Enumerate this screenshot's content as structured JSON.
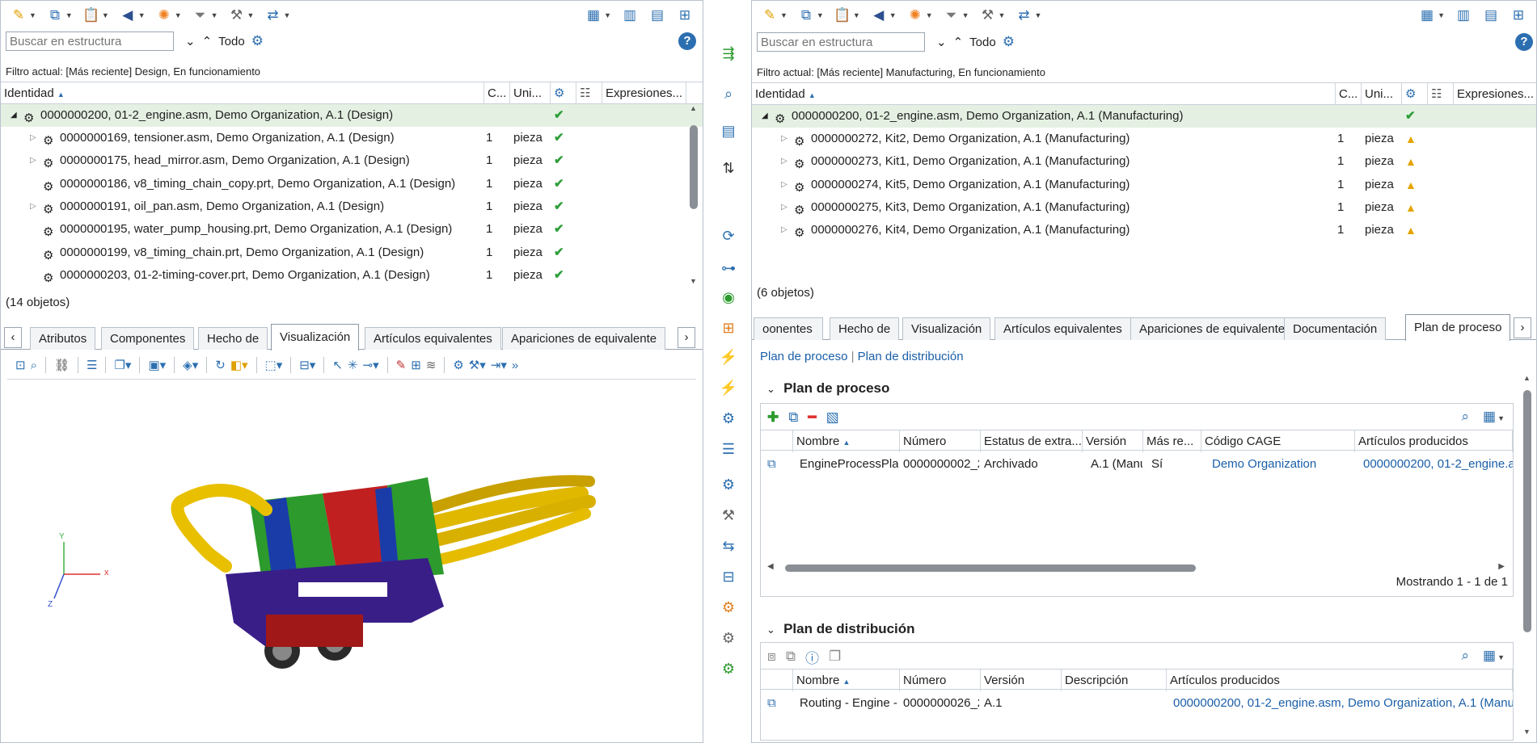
{
  "left": {
    "search": {
      "placeholder": "Buscar en estructura"
    },
    "all_label": "Todo",
    "filter": "Filtro actual: [Más reciente] Design, En funcionamiento",
    "columns": [
      "Identidad",
      "C...",
      "Uni...",
      "Expresiones..."
    ],
    "root": {
      "text": "0000000200, 01-2_engine.asm, Demo Organization, A.1 (Design)"
    },
    "rows": [
      {
        "text": "0000000169, tensioner.asm, Demo Organization, A.1 (Design)",
        "qty": "1",
        "unit": "pieza",
        "expand": true
      },
      {
        "text": "0000000175, head_mirror.asm, Demo Organization, A.1 (Design)",
        "qty": "1",
        "unit": "pieza",
        "expand": true
      },
      {
        "text": "0000000186, v8_timing_chain_copy.prt, Demo Organization, A.1 (Design)",
        "qty": "1",
        "unit": "pieza",
        "expand": false
      },
      {
        "text": "0000000191, oil_pan.asm, Demo Organization, A.1 (Design)",
        "qty": "1",
        "unit": "pieza",
        "expand": true
      },
      {
        "text": "0000000195, water_pump_housing.prt, Demo Organization, A.1 (Design)",
        "qty": "1",
        "unit": "pieza",
        "expand": false
      },
      {
        "text": "0000000199, v8_timing_chain.prt, Demo Organization, A.1 (Design)",
        "qty": "1",
        "unit": "pieza",
        "expand": false
      },
      {
        "text": "0000000203, 01-2-timing-cover.prt, Demo Organization, A.1 (Design)",
        "qty": "1",
        "unit": "pieza",
        "expand": false
      }
    ],
    "count": "(14 objetos)",
    "tabs": [
      "Atributos",
      "Componentes",
      "Hecho de",
      "Visualización",
      "Artículos equivalentes",
      "Apariciones de equivalente"
    ],
    "active_tab": "Visualización",
    "axes": {
      "y": "Y",
      "x": "x",
      "z": "Z"
    }
  },
  "right": {
    "search": {
      "placeholder": "Buscar en estructura"
    },
    "all_label": "Todo",
    "filter": "Filtro actual: [Más reciente] Manufacturing, En funcionamiento",
    "columns": [
      "Identidad",
      "C...",
      "Uni...",
      "Expresiones..."
    ],
    "root": {
      "text": "0000000200, 01-2_engine.asm, Demo Organization, A.1 (Manufacturing)"
    },
    "rows": [
      {
        "text": "0000000272, Kit2, Demo Organization, A.1 (Manufacturing)",
        "qty": "1",
        "unit": "pieza"
      },
      {
        "text": "0000000273, Kit1, Demo Organization, A.1 (Manufacturing)",
        "qty": "1",
        "unit": "pieza"
      },
      {
        "text": "0000000274, Kit5, Demo Organization, A.1 (Manufacturing)",
        "qty": "1",
        "unit": "pieza"
      },
      {
        "text": "0000000275, Kit3, Demo Organization, A.1 (Manufacturing)",
        "qty": "1",
        "unit": "pieza"
      },
      {
        "text": "0000000276, Kit4, Demo Organization, A.1 (Manufacturing)",
        "qty": "1",
        "unit": "pieza"
      }
    ],
    "count": "(6 objetos)",
    "tabs": [
      "oonentes",
      "Hecho de",
      "Visualización",
      "Artículos equivalentes",
      "Apariciones de equivalente",
      "Documentación",
      "Plan de proceso"
    ],
    "active_tab": "Plan de proceso",
    "sublinks": [
      "Plan de proceso",
      "Plan de distribución"
    ],
    "process_plan": {
      "title": "Plan de proceso",
      "columns": [
        "Nombre",
        "Número",
        "Estatus de extra...",
        "Versión",
        "Más re...",
        "Código CAGE",
        "Artículos producidos"
      ],
      "row": {
        "name": "EngineProcessPlar",
        "number": "0000000002_2",
        "status": "Archivado",
        "version": "A.1 (Manu",
        "latest": "Sí",
        "cage": "Demo Organization",
        "produced": "0000000200, 01-2_engine.a"
      },
      "footer": "Mostrando 1 - 1 de 1"
    },
    "distribution_plan": {
      "title": "Plan de distribución",
      "columns": [
        "Nombre",
        "Número",
        "Versión",
        "Descripción",
        "Artículos producidos"
      ],
      "row": {
        "name": "Routing - Engine -",
        "number": "0000000026_2",
        "version": "A.1",
        "description": "",
        "produced": "0000000200, 01-2_engine.asm, Demo Organization, A.1 (Manu"
      }
    }
  },
  "colors": {
    "accent": "#1a5fa8",
    "selected_row": "#e4f1e2",
    "check": "#2e9e3a",
    "warning": "#e5a400"
  }
}
